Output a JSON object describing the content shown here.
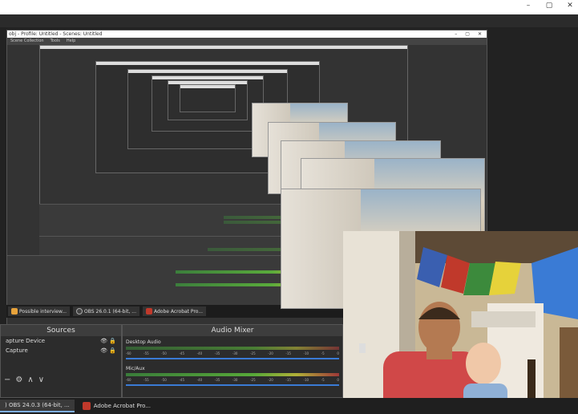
{
  "window": {
    "controls": [
      "–",
      "▢",
      "✕"
    ]
  },
  "obs_nested": {
    "title": "obj - Profile: Untitled - Scenes: Untitled",
    "menu": [
      "Scene Collection",
      "Tools",
      "Help"
    ],
    "controls": [
      "–",
      "▢",
      "✕"
    ]
  },
  "sources_panel": {
    "title": "Sources",
    "items": [
      {
        "label": "apture Device"
      },
      {
        "label": "Capture"
      }
    ],
    "controls": [
      "+",
      "−",
      "⚙",
      "∧",
      "∨"
    ]
  },
  "audio_mixer": {
    "title": "Audio Mixer",
    "channels": [
      {
        "label": "Desktop Audio"
      },
      {
        "label": "Mic/Aux"
      }
    ],
    "ticks": [
      "-60",
      "-55",
      "-50",
      "-45",
      "-40",
      "-35",
      "-30",
      "-25",
      "-20",
      "-15",
      "-10",
      "-5",
      "0"
    ]
  },
  "taskbar_nested": {
    "items": [
      {
        "label": "Possible interview...",
        "icon_color": "#e8a33b"
      },
      {
        "label": "OBS 26.0.1 (64-bit, ...",
        "icon_color": "#444444"
      },
      {
        "label": "Adobe Acrobat Pro...",
        "icon_color": "#c0392b"
      }
    ]
  },
  "taskbar": {
    "items": [
      {
        "label": ") OBS 24.0.3 (64-bit, ...",
        "active": true
      },
      {
        "label": "Adobe Acrobat Pro...",
        "active": false
      }
    ]
  },
  "colors": {
    "flag_red": "#c0392b",
    "flag_yellow": "#e6d23a",
    "flag_green": "#3c8a3c",
    "flag_blue": "#3a5fb0",
    "shirt_red": "#d04848"
  }
}
